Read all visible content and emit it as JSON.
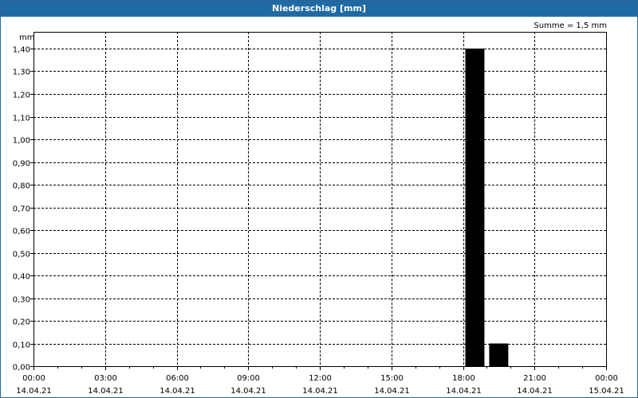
{
  "window": {
    "title": "Niederschlag [mm]"
  },
  "summary": "Summe = 1,5 mm",
  "chart_data": {
    "type": "bar",
    "title": "Niederschlag [mm]",
    "ylabel": "mm",
    "ylim": [
      0,
      1.4
    ],
    "yticks": [
      "0,00",
      "0,10",
      "0,20",
      "0,30",
      "0,40",
      "0,50",
      "0,60",
      "0,70",
      "0,80",
      "0,90",
      "1,00",
      "1,10",
      "1,20",
      "1,30",
      "1,40"
    ],
    "xlim_hours": [
      0,
      24
    ],
    "xticks": [
      {
        "hour": 0,
        "time": "00:00",
        "date": "14.04.21"
      },
      {
        "hour": 3,
        "time": "03:00",
        "date": "14.04.21"
      },
      {
        "hour": 6,
        "time": "06:00",
        "date": "14.04.21"
      },
      {
        "hour": 9,
        "time": "09:00",
        "date": "14.04.21"
      },
      {
        "hour": 12,
        "time": "12:00",
        "date": "14.04.21"
      },
      {
        "hour": 15,
        "time": "15:00",
        "date": "14.04.21"
      },
      {
        "hour": 18,
        "time": "18:00",
        "date": "14.04.21"
      },
      {
        "hour": 21,
        "time": "21:00",
        "date": "14.04.21"
      },
      {
        "hour": 24,
        "time": "00:00",
        "date": "15.04.21"
      }
    ],
    "bars": [
      {
        "start_hour": 18,
        "end_hour": 19,
        "value": 1.4
      },
      {
        "start_hour": 19,
        "end_hour": 20,
        "value": 0.1
      }
    ],
    "grid": true,
    "bar_color": "#000000",
    "summary": "Summe = 1,5 mm"
  }
}
